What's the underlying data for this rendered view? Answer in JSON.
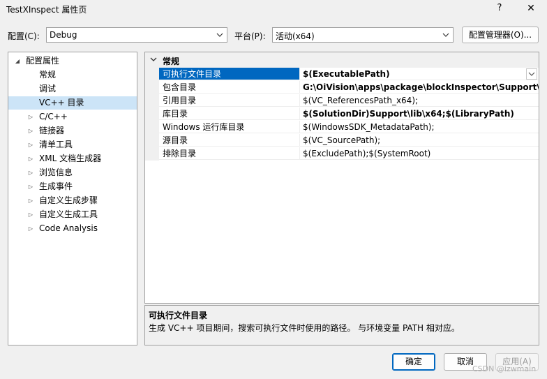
{
  "window": {
    "title": "TestXInspect 属性页",
    "help": "?",
    "close": "✕"
  },
  "config": {
    "label": "配置(C):",
    "value": "Debug"
  },
  "platform": {
    "label": "平台(P):",
    "value": "活动(x64)"
  },
  "config_manager": "配置管理器(O)...",
  "tree": {
    "root": "配置属性",
    "items": [
      {
        "label": "常规",
        "expandable": false
      },
      {
        "label": "调试",
        "expandable": false
      },
      {
        "label": "VC++ 目录",
        "expandable": false,
        "selected": true
      },
      {
        "label": "C/C++",
        "expandable": true
      },
      {
        "label": "链接器",
        "expandable": true
      },
      {
        "label": "清单工具",
        "expandable": true
      },
      {
        "label": "XML 文档生成器",
        "expandable": true
      },
      {
        "label": "浏览信息",
        "expandable": true
      },
      {
        "label": "生成事件",
        "expandable": true
      },
      {
        "label": "自定义生成步骤",
        "expandable": true
      },
      {
        "label": "自定义生成工具",
        "expandable": true
      },
      {
        "label": "Code Analysis",
        "expandable": true
      }
    ]
  },
  "grid": {
    "category": "常规",
    "rows": [
      {
        "name": "可执行文件目录",
        "value": "$(ExecutablePath)",
        "bold": true,
        "selected": true
      },
      {
        "name": "包含目录",
        "value": "G:\\OiVision\\apps\\package\\blockInspector\\Support\\incl",
        "bold": true
      },
      {
        "name": "引用目录",
        "value": "$(VC_ReferencesPath_x64);",
        "bold": false
      },
      {
        "name": "库目录",
        "value": "$(SolutionDir)Support\\lib\\x64;$(LibraryPath)",
        "bold": true
      },
      {
        "name": "Windows 运行库目录",
        "value": "$(WindowsSDK_MetadataPath);",
        "bold": false
      },
      {
        "name": "源目录",
        "value": "$(VC_SourcePath);",
        "bold": false
      },
      {
        "name": "排除目录",
        "value": "$(ExcludePath);$(SystemRoot)",
        "bold": false
      }
    ]
  },
  "description": {
    "title": "可执行文件目录",
    "text": "生成 VC++ 项目期间，搜索可执行文件时使用的路径。 与环境变量 PATH 相对应。"
  },
  "buttons": {
    "ok": "确定",
    "cancel": "取消",
    "apply": "应用(A)"
  },
  "watermark": "CSDN @izwmain",
  "colors": {
    "selection": "#0067c0",
    "tree_selection": "#cce4f7",
    "background": "#f0f0f0"
  }
}
